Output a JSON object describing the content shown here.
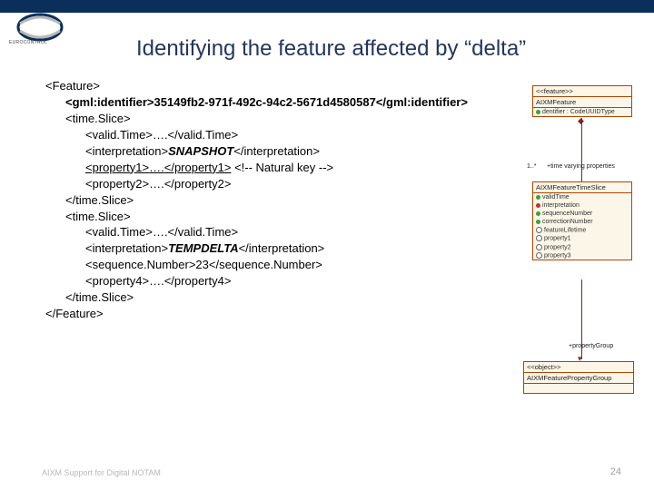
{
  "logo_text": "EUROCONTROL",
  "title": "Identifying the feature affected by “delta”",
  "code": {
    "l0": "<Feature>",
    "l1a": "<gml:identifier>",
    "l1b": "35149fb2-971f-492c-94c2-5671d4580587",
    "l1c": "</gml:identifier>",
    "l2": "<time.Slice>",
    "l3": "<valid.Time>….</valid.Time>",
    "l4a": "<interpretation>",
    "l4b": "SNAPSHOT",
    "l4c": "</interpretation>",
    "l5a": "<property1>",
    "l5b": "….",
    "l5c": "</property1>",
    "l5d": " <!-- Natural key -->",
    "l6": "<property2>….</property2>",
    "l7": "</time.Slice>",
    "l8": "<time.Slice>",
    "l9": "<valid.Time>….</valid.Time>",
    "l10a": "<interpretation>",
    "l10b": "TEMPDELTA",
    "l10c": "</interpretation>",
    "l11": "<sequence.Number>23</sequence.Number>",
    "l12": "<property4>….</property4>",
    "l13": "</time.Slice>",
    "l14": "</Feature>"
  },
  "diagram": {
    "box1_head": "<<feature>>",
    "box1_name": "AIXMFeature",
    "box1_row": "dentifier : CodeUUIDType",
    "mult1": "1..*",
    "assoc1": "+time varying properties",
    "box2_name": "AIXMFeatureTimeSlice",
    "box2_rows": [
      "validTime",
      "interpretation",
      "sequenceNumber",
      "correctionNumber",
      "featureLifetime",
      "property1",
      "property2",
      "property3"
    ],
    "assoc2": "+propertyGroup",
    "box3_head": "<<object>>",
    "box3_name": "AIXMFeaturePropertyGroup"
  },
  "footer_left": "AIXM Support for Digital NOTAM",
  "footer_right": "24"
}
